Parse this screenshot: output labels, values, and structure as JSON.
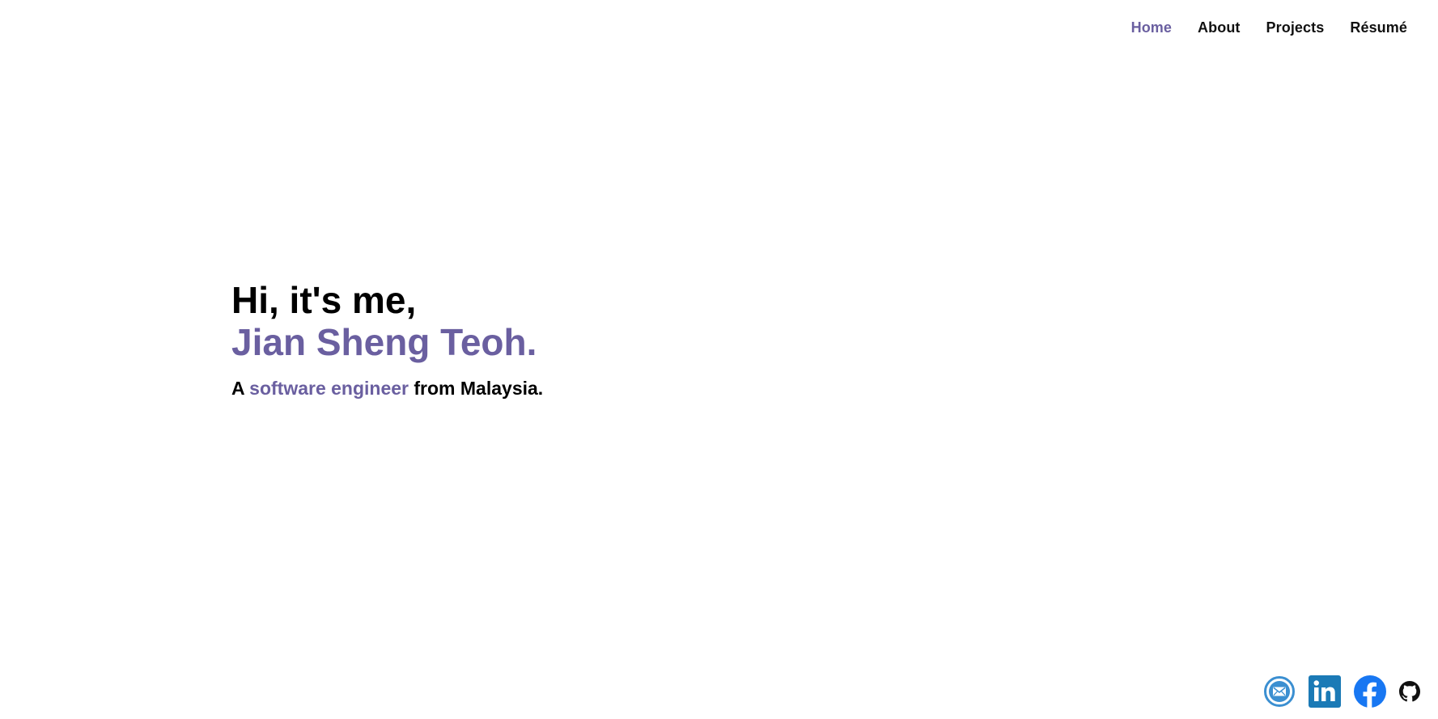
{
  "nav": {
    "items": [
      {
        "label": "Home",
        "active": true
      },
      {
        "label": "About",
        "active": false
      },
      {
        "label": "Projects",
        "active": false
      },
      {
        "label": "Résumé",
        "active": false
      }
    ]
  },
  "hero": {
    "greeting": "Hi, it's me,",
    "name": "Jian Sheng Teoh.",
    "sub_prefix": "A ",
    "sub_highlight": "software engineer",
    "sub_suffix": " from Malaysia."
  },
  "socials": [
    {
      "icon": "email-icon",
      "color": "#3b8fd1"
    },
    {
      "icon": "linkedin-icon",
      "color": "#1b7ab6"
    },
    {
      "icon": "facebook-icon",
      "color": "#1877f2"
    },
    {
      "icon": "github-icon",
      "color": "#111111"
    }
  ],
  "colors": {
    "accent": "#6a5fa0",
    "text": "#000000",
    "background": "#ffffff"
  }
}
